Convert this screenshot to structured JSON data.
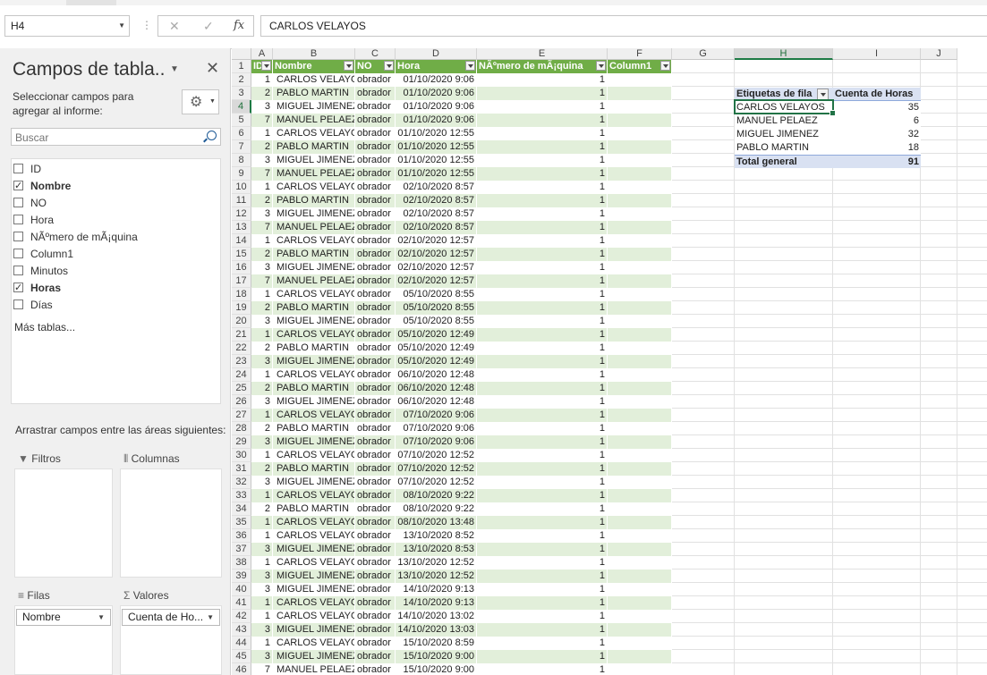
{
  "formula_bar": {
    "name_box": "H4",
    "cancel_icon": "✕",
    "enter_icon": "✓",
    "fx_label": "fx",
    "content": "CARLOS VELAYOS"
  },
  "field_panel": {
    "title": "Campos de tabla..",
    "subtitle": "Seleccionar campos para agregar al informe:",
    "search_placeholder": "Buscar",
    "fields": [
      {
        "label": "ID",
        "checked": false
      },
      {
        "label": "Nombre",
        "checked": true
      },
      {
        "label": "NO",
        "checked": false
      },
      {
        "label": "Hora",
        "checked": false
      },
      {
        "label": "NÃºmero de mÃ¡quina",
        "checked": false
      },
      {
        "label": "Column1",
        "checked": false
      },
      {
        "label": "Minutos",
        "checked": false
      },
      {
        "label": "Horas",
        "checked": true
      },
      {
        "label": "Días",
        "checked": false
      }
    ],
    "more_tables": "Más tablas...",
    "drag_hint": "Arrastrar campos entre las áreas siguientes:",
    "areas": {
      "filters": "Filtros",
      "columns": "Columnas",
      "rows": "Filas",
      "values": "Valores",
      "rows_field": "Nombre",
      "values_field": "Cuenta de Ho..."
    }
  },
  "sheet": {
    "columns": [
      "A",
      "B",
      "C",
      "D",
      "E",
      "F",
      "G",
      "H",
      "I",
      "J"
    ],
    "active_column": "H",
    "active_row": 4,
    "table_headers": [
      "ID",
      "Nombre",
      "NO",
      "Hora",
      "NÃºmero de mÃ¡quina",
      "Column1"
    ],
    "rows": [
      [
        1,
        "CARLOS VELAYOS",
        "obrador",
        "01/10/2020 9:06",
        1
      ],
      [
        2,
        "PABLO MARTIN",
        "obrador",
        "01/10/2020 9:06",
        1
      ],
      [
        3,
        "MIGUEL JIMENEZ",
        "obrador",
        "01/10/2020 9:06",
        1
      ],
      [
        7,
        "MANUEL PELAEZ",
        "obrador",
        "01/10/2020 9:06",
        1
      ],
      [
        1,
        "CARLOS VELAYOS",
        "obrador",
        "01/10/2020 12:55",
        1
      ],
      [
        2,
        "PABLO MARTIN",
        "obrador",
        "01/10/2020 12:55",
        1
      ],
      [
        3,
        "MIGUEL JIMENEZ",
        "obrador",
        "01/10/2020 12:55",
        1
      ],
      [
        7,
        "MANUEL PELAEZ",
        "obrador",
        "01/10/2020 12:55",
        1
      ],
      [
        1,
        "CARLOS VELAYOS",
        "obrador",
        "02/10/2020 8:57",
        1
      ],
      [
        2,
        "PABLO MARTIN",
        "obrador",
        "02/10/2020 8:57",
        1
      ],
      [
        3,
        "MIGUEL JIMENEZ",
        "obrador",
        "02/10/2020 8:57",
        1
      ],
      [
        7,
        "MANUEL PELAEZ",
        "obrador",
        "02/10/2020 8:57",
        1
      ],
      [
        1,
        "CARLOS VELAYOS",
        "obrador",
        "02/10/2020 12:57",
        1
      ],
      [
        2,
        "PABLO MARTIN",
        "obrador",
        "02/10/2020 12:57",
        1
      ],
      [
        3,
        "MIGUEL JIMENEZ",
        "obrador",
        "02/10/2020 12:57",
        1
      ],
      [
        7,
        "MANUEL PELAEZ",
        "obrador",
        "02/10/2020 12:57",
        1
      ],
      [
        1,
        "CARLOS VELAYOS",
        "obrador",
        "05/10/2020 8:55",
        1
      ],
      [
        2,
        "PABLO MARTIN",
        "obrador",
        "05/10/2020 8:55",
        1
      ],
      [
        3,
        "MIGUEL JIMENEZ",
        "obrador",
        "05/10/2020 8:55",
        1
      ],
      [
        1,
        "CARLOS VELAYOS",
        "obrador",
        "05/10/2020 12:49",
        1
      ],
      [
        2,
        "PABLO MARTIN",
        "obrador",
        "05/10/2020 12:49",
        1
      ],
      [
        3,
        "MIGUEL JIMENEZ",
        "obrador",
        "05/10/2020 12:49",
        1
      ],
      [
        1,
        "CARLOS VELAYOS",
        "obrador",
        "06/10/2020 12:48",
        1
      ],
      [
        2,
        "PABLO MARTIN",
        "obrador",
        "06/10/2020 12:48",
        1
      ],
      [
        3,
        "MIGUEL JIMENEZ",
        "obrador",
        "06/10/2020 12:48",
        1
      ],
      [
        1,
        "CARLOS VELAYOS",
        "obrador",
        "07/10/2020 9:06",
        1
      ],
      [
        2,
        "PABLO MARTIN",
        "obrador",
        "07/10/2020 9:06",
        1
      ],
      [
        3,
        "MIGUEL JIMENEZ",
        "obrador",
        "07/10/2020 9:06",
        1
      ],
      [
        1,
        "CARLOS VELAYOS",
        "obrador",
        "07/10/2020 12:52",
        1
      ],
      [
        2,
        "PABLO MARTIN",
        "obrador",
        "07/10/2020 12:52",
        1
      ],
      [
        3,
        "MIGUEL JIMENEZ",
        "obrador",
        "07/10/2020 12:52",
        1
      ],
      [
        1,
        "CARLOS VELAYOS",
        "obrador",
        "08/10/2020 9:22",
        1
      ],
      [
        2,
        "PABLO MARTIN",
        "obrador",
        "08/10/2020 9:22",
        1
      ],
      [
        1,
        "CARLOS VELAYOS",
        "obrador",
        "08/10/2020 13:48",
        1
      ],
      [
        1,
        "CARLOS VELAYOS",
        "obrador",
        "13/10/2020 8:52",
        1
      ],
      [
        3,
        "MIGUEL JIMENEZ",
        "obrador",
        "13/10/2020 8:53",
        1
      ],
      [
        1,
        "CARLOS VELAYOS",
        "obrador",
        "13/10/2020 12:52",
        1
      ],
      [
        3,
        "MIGUEL JIMENEZ",
        "obrador",
        "13/10/2020 12:52",
        1
      ],
      [
        3,
        "MIGUEL JIMENEZ",
        "obrador",
        "14/10/2020 9:13",
        1
      ],
      [
        1,
        "CARLOS VELAYOS",
        "obrador",
        "14/10/2020 9:13",
        1
      ],
      [
        1,
        "CARLOS VELAYOS",
        "obrador",
        "14/10/2020 13:02",
        1
      ],
      [
        3,
        "MIGUEL JIMENEZ",
        "obrador",
        "14/10/2020 13:03",
        1
      ],
      [
        1,
        "CARLOS VELAYOS",
        "obrador",
        "15/10/2020 8:59",
        1
      ],
      [
        3,
        "MIGUEL JIMENEZ",
        "obrador",
        "15/10/2020 9:00",
        1
      ],
      [
        7,
        "MANUEL PELAEZ",
        "obrador",
        "15/10/2020 9:00",
        1
      ]
    ],
    "pivot": {
      "row_label": "Etiquetas de fila",
      "value_label": "Cuenta de Horas",
      "items": [
        {
          "name": "CARLOS VELAYOS",
          "value": 35
        },
        {
          "name": "MANUEL PELAEZ",
          "value": 6
        },
        {
          "name": "MIGUEL JIMENEZ",
          "value": 32
        },
        {
          "name": "PABLO MARTIN",
          "value": 18
        }
      ],
      "total_label": "Total general",
      "total_value": 91
    }
  }
}
